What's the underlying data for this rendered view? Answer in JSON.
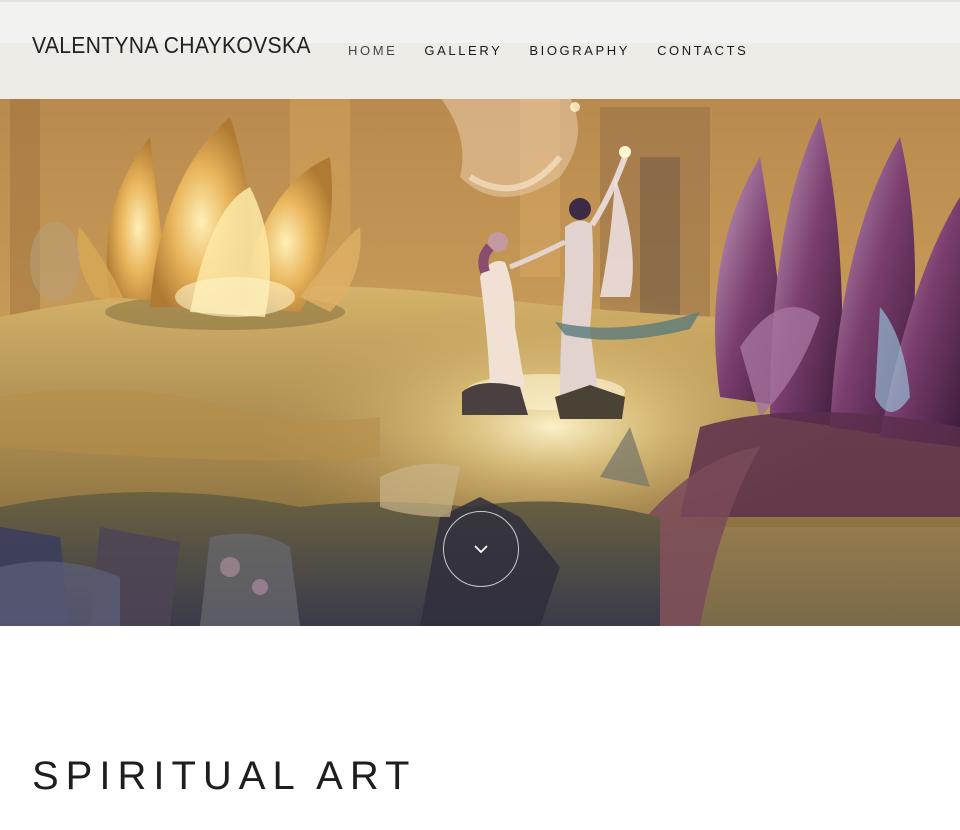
{
  "site": {
    "title": "VALENTYNA CHAYKOVSKA"
  },
  "nav": {
    "items": [
      {
        "label": "HOME",
        "active": true
      },
      {
        "label": "GALLERY",
        "active": false
      },
      {
        "label": "BIOGRAPHY",
        "active": false
      },
      {
        "label": "CONTACTS",
        "active": false
      }
    ]
  },
  "hero": {
    "image": "fantasy-painting-dancing-couple-lotus-flowers",
    "scroll_icon": "chevron-down-icon"
  },
  "content": {
    "heading": "SPIRITUAL ART"
  },
  "colors": {
    "header_bg": "#f2f2f0",
    "text": "#1e1e1e",
    "page_bg": "#ffffff"
  }
}
